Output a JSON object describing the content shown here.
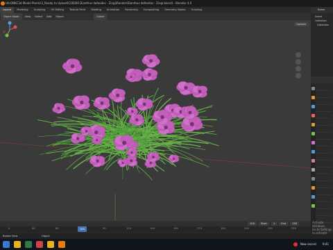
{
  "window": {
    "title": "HA-DNKC3d Model Plants\\3_Ready to Upload\\C00000 Dianthus deltoides - Zingi\\Render\\Dianthus deltoides - Zingi.blend) - Blender 4.0"
  },
  "menubar": {
    "tabs": [
      "Layout",
      "Modeling",
      "Sculpting",
      "UV Editing",
      "Texture Paint",
      "Shading",
      "Animation",
      "Rendering",
      "Compositing",
      "Geometry Nodes",
      "Scripting"
    ],
    "active": "Layout"
  },
  "viewport_header": {
    "items": [
      "Object Mode",
      "View",
      "Select",
      "Add",
      "Object"
    ],
    "orientation": "Global",
    "options_label": "Options"
  },
  "outliner": {
    "title": "Scene",
    "items": [
      "Scene Collection",
      "Collection"
    ]
  },
  "timeline": {
    "ticks": [
      "0",
      "40",
      "60",
      "70",
      "90",
      "110",
      "130",
      "150",
      "170",
      "190",
      "210",
      "230",
      "250"
    ],
    "current_frame": "100",
    "start": "1",
    "end": "250",
    "start_label": "Start",
    "end_label": "End"
  },
  "status": {
    "left_text": "Rotate View",
    "right_text": "Object"
  },
  "watermark": {
    "line1": "Activate Windows",
    "line2": "Go to Settings to activate"
  },
  "taskbar": {
    "tray_text": "New record",
    "time": "9:41"
  },
  "colors": {
    "petal": "#d070c8",
    "petal_dark": "#a04a9c",
    "leaf": "#4e9a3a",
    "accent": "#4772b3",
    "blender_orange": "#e87d0d"
  }
}
